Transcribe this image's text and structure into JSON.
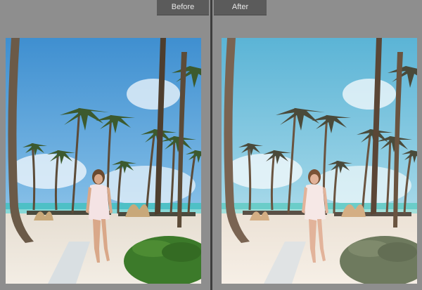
{
  "compare_view": {
    "before_label": "Before",
    "after_label": "After"
  },
  "colors": {
    "panel_bg": "#8e8e8e",
    "tab_bg": "#5b5b5b",
    "tab_text": "#e6e6e6",
    "divider": "#3e3e3e"
  }
}
